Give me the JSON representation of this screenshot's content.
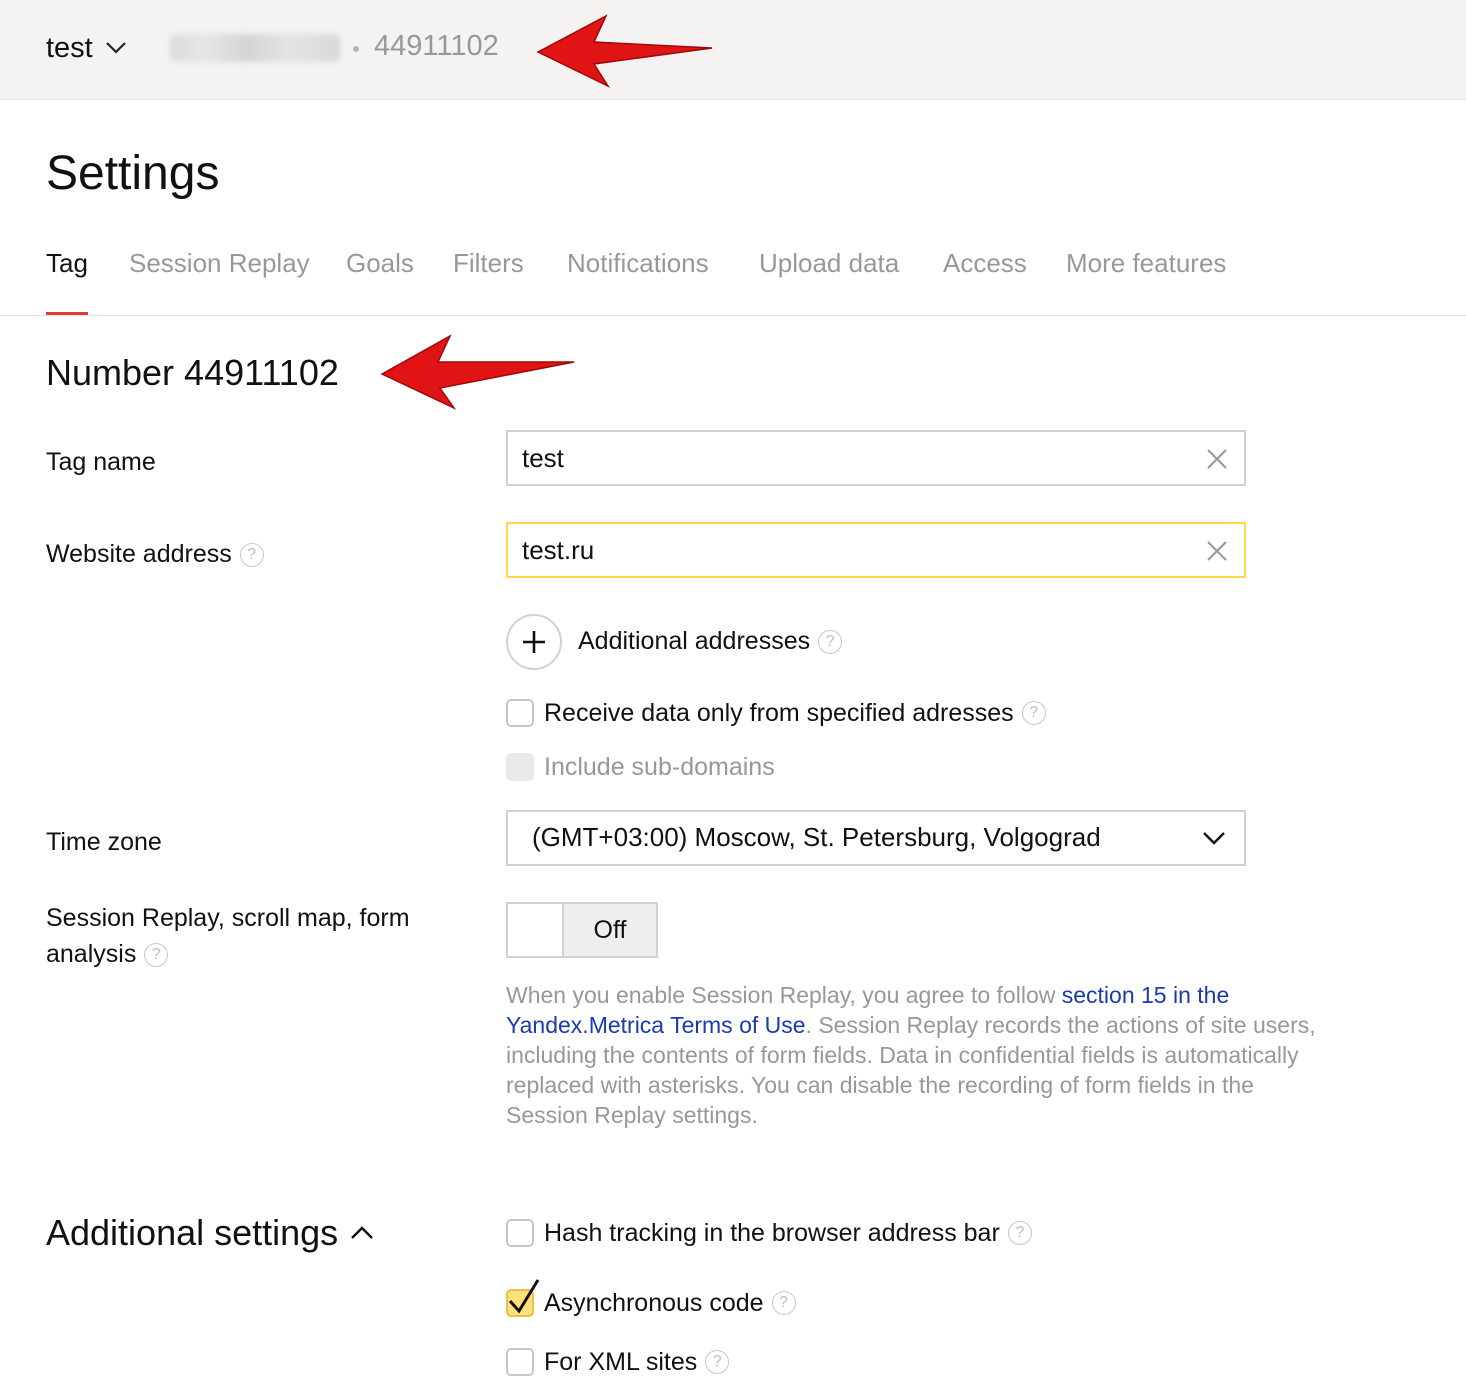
{
  "header": {
    "counter_name": "test",
    "counter_id": "44911102"
  },
  "page": {
    "title": "Settings"
  },
  "tabs": [
    {
      "label": "Tag",
      "active": true
    },
    {
      "label": "Session Replay"
    },
    {
      "label": "Goals"
    },
    {
      "label": "Filters"
    },
    {
      "label": "Notifications"
    },
    {
      "label": "Upload data"
    },
    {
      "label": "Access"
    },
    {
      "label": "More features"
    }
  ],
  "tag": {
    "number_title": "Number 44911102",
    "name_label": "Tag name",
    "name_value": "test",
    "website_label": "Website address",
    "website_value": "test.ru",
    "additional_addresses": "Additional addresses",
    "receive_only_label": "Receive data only from specified adresses",
    "include_subdomains_label": "Include sub-domains",
    "timezone_label": "Time zone",
    "timezone_value": "(GMT+03:00) Moscow, St. Petersburg, Volgograd",
    "session_replay_label": "Session Replay, scroll map, form analysis",
    "session_replay_state": "Off",
    "notice_part1": "When you enable Session Replay, you agree to follow ",
    "notice_link": "section 15 in the Yandex.Metrica Terms of Use",
    "notice_part2": ". Session Replay records the actions of site users, including the contents of form fields. Data in confidential fields is automatically replaced with asterisks. You can disable the recording of form fields in the Session Replay settings."
  },
  "additional_settings": {
    "title": "Additional settings",
    "hash_tracking": {
      "label": "Hash tracking in the browser address bar",
      "checked": false
    },
    "async_code": {
      "label": "Asynchronous code",
      "checked": true
    },
    "xml_sites": {
      "label": "For XML sites",
      "checked": false
    }
  },
  "icons": {
    "help": "?"
  },
  "colors": {
    "accent_red": "#e63a2e",
    "focus_yellow": "#ffd64d",
    "link_blue": "#1a3bb0",
    "checked_yellow": "#ffe07a"
  }
}
